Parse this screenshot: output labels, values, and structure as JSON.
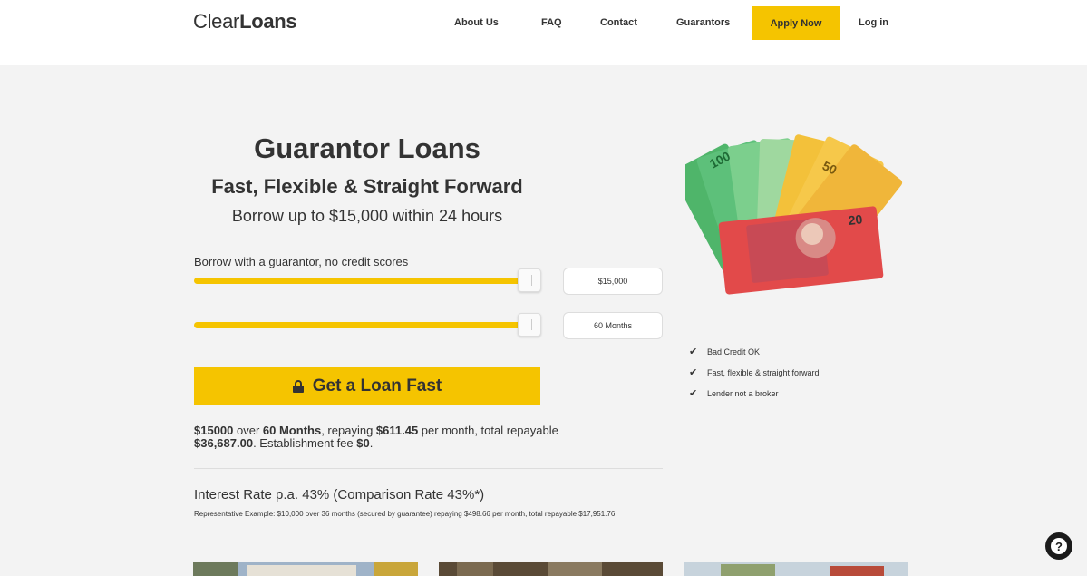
{
  "header": {
    "logo_light": "Clear",
    "logo_bold": "Loans",
    "nav": {
      "about": "About Us",
      "faq": "FAQ",
      "contact": "Contact",
      "guarantors": "Guarantors",
      "apply": "Apply Now",
      "login": "Log in"
    }
  },
  "hero": {
    "title": "Guarantor Loans",
    "subtitle": "Fast, Flexible & Straight Forward",
    "tagline": "Borrow up to $15,000 within 24 hours"
  },
  "calculator": {
    "label": "Borrow with a guarantor, no credit scores",
    "amount_value": "$15,000",
    "amount_fraction": 1.0,
    "term_value": "60 Months",
    "term_fraction": 1.0,
    "cta_label": "Get a Loan Fast",
    "cta_icon": "lock-icon",
    "summary": {
      "amount": "$15000",
      "over": " over ",
      "term": "60 Months",
      "repaying": ", repaying ",
      "monthly": "$611.45",
      "per_month": " per month, total repayable ",
      "total": "$36,687.00",
      "fee_text": ". Establishment fee ",
      "fee": "$0",
      "end": "."
    },
    "rate": "Interest Rate p.a. 43% (Comparison Rate 43%*)",
    "representative": "Representative Example: $10,000 over 36 months (secured by guarantee) repaying $498.66 per month, total repayable $17,951.76."
  },
  "features": [
    "Bad Credit OK",
    "Fast, flexible & straight forward",
    "Lender not a broker"
  ],
  "colors": {
    "accent": "#f5c400",
    "text": "#333333",
    "background": "#f3f3f3"
  },
  "help": {
    "icon": "help-icon",
    "glyph": "?"
  }
}
